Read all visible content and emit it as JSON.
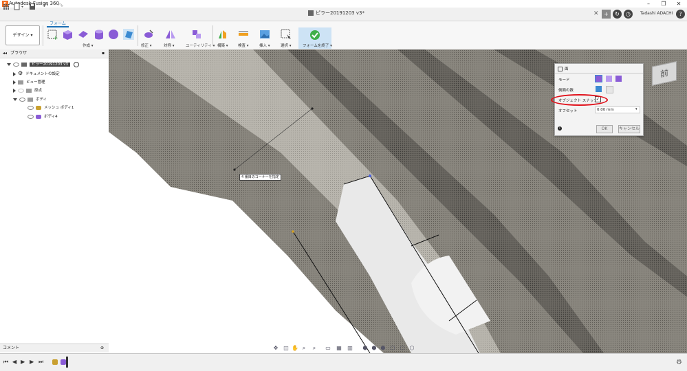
{
  "app": {
    "title": "Autodesk Fusion 360"
  },
  "document": {
    "tab_title": "ピラー20191203 v3*"
  },
  "user": {
    "name": "Tadashi ADACHI"
  },
  "ribbon": {
    "workspace_button": "デザイン ▾",
    "active_tab": "フォーム",
    "groups": [
      {
        "label": "作成 ▾"
      },
      {
        "label": "修正 ▾"
      },
      {
        "label": "対称 ▾"
      },
      {
        "label": "ユーティリティ ▾"
      },
      {
        "label": "構築 ▾"
      },
      {
        "label": "検査 ▾"
      },
      {
        "label": "挿入 ▾"
      },
      {
        "label": "選択 ▾"
      },
      {
        "label": "フォームを終了 ▾"
      }
    ]
  },
  "browser": {
    "title": "ブラウザ",
    "items": [
      {
        "label": "ピラー20191203 v3"
      },
      {
        "label": "ドキュメントの設定"
      },
      {
        "label": "ビュー管理"
      },
      {
        "label": "原点"
      },
      {
        "label": "ボディ"
      },
      {
        "label": "メッシュ ボディ1"
      },
      {
        "label": "ボディ4"
      }
    ]
  },
  "comment": {
    "label": "コメント"
  },
  "canvas": {
    "tooltip": "4 番目のコーナーを指定",
    "viewcube_face": "前"
  },
  "dialog": {
    "title": "面",
    "mode_label": "モード",
    "sides_label": "側面の数",
    "object_snap_label": "オブジェクト スナップ",
    "offset_label": "オフセット",
    "offset_value": "0.00 mm",
    "ok_label": "OK",
    "cancel_label": "キャンセル"
  },
  "colors": {
    "accent_blue": "#1a6fb5",
    "form_purple": "#8a5cd6",
    "finish_green": "#3fae49",
    "highlight_red": "#e0101a",
    "mesh_gray": "#7a776f"
  }
}
